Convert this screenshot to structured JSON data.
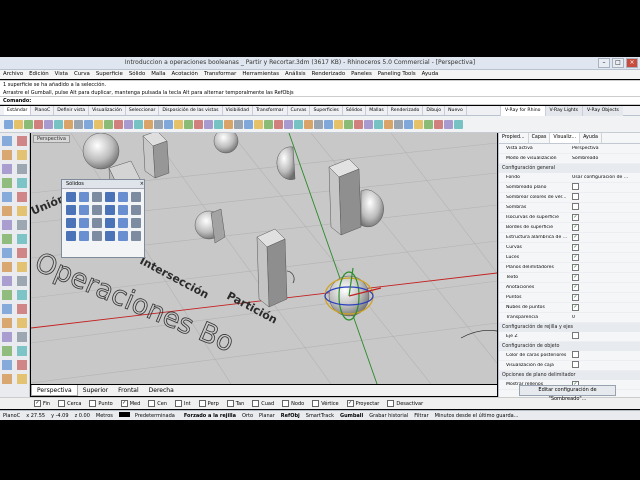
{
  "window": {
    "title": "Introduccion a operaciones booleanas _ Partir y Recortar.3dm (3617 KB) - Rhinoceros 5.0 Commercial - [Perspectiva]"
  },
  "menu": [
    "Archivo",
    "Edición",
    "Vista",
    "Curva",
    "Superficie",
    "Sólido",
    "Malla",
    "Acotación",
    "Transformar",
    "Herramientas",
    "Análisis",
    "Renderizado",
    "Paneles",
    "Paneling Tools",
    "Ayuda"
  ],
  "command_history": [
    "1 superficie se ha añadido a la selección.",
    "Arrastre el Gumball, pulse Alt para duplicar, mantenga pulsada la tecla Alt para alternar temporalmente las RefObjs"
  ],
  "command_prompt": "Comando:",
  "tabs": [
    "Estándar",
    "PlanoC",
    "Definir vista",
    "Visualización",
    "Seleccionar",
    "Disposición de las vistas",
    "Visibilidad",
    "Transformar",
    "Curvas",
    "Superficies",
    "Sólidos",
    "Mallas",
    "Renderizado",
    "Dibujo",
    "Nuevo"
  ],
  "active_tab_index": 0,
  "vray_tabs": [
    "V-Ray for Rhino",
    "V-Ray Lights",
    "V-Ray Objects"
  ],
  "viewport": {
    "label": "Perspectiva",
    "texts": {
      "union": "Unión",
      "interseccion": "Intersección",
      "particion": "Partición",
      "operaciones": "Operaciones Bo"
    }
  },
  "solids_panel": {
    "title": "Sólidos"
  },
  "viewport_tabs": [
    "Perspectiva",
    "Superior",
    "Frontal",
    "Derecha"
  ],
  "osnaps": [
    {
      "label": "Fin",
      "checked": true
    },
    {
      "label": "Cerca",
      "checked": false
    },
    {
      "label": "Punto",
      "checked": false
    },
    {
      "label": "Med",
      "checked": true
    },
    {
      "label": "Cen",
      "checked": false
    },
    {
      "label": "Int",
      "checked": false
    },
    {
      "label": "Perp",
      "checked": false
    },
    {
      "label": "Tan",
      "checked": false
    },
    {
      "label": "Cuad",
      "checked": false
    },
    {
      "label": "Nodo",
      "checked": false
    },
    {
      "label": "Vértice",
      "checked": false
    },
    {
      "label": "Proyectar",
      "checked": true
    },
    {
      "label": "Desactivar",
      "checked": false
    }
  ],
  "status": {
    "plane": "PlanoC",
    "x": "x 27.55",
    "y": "y -4.09",
    "z": "z 0.00",
    "units": "Metros",
    "layer": "Predeterminada",
    "buttons": [
      "Forzado a la rejilla",
      "Orto",
      "Planar",
      "RefObj",
      "SmartTrack",
      "Gumball",
      "Grabar historial",
      "Filtrar",
      "Minutos desde el último guarda..."
    ]
  },
  "right_panel": {
    "tabs": [
      "Propied...",
      "Capas",
      "Visualiz...",
      "Ayuda"
    ],
    "active_tab_index": 2,
    "rows": [
      {
        "k": "Vista activa",
        "v": "Perspectiva",
        "type": "text"
      },
      {
        "k": "Modo de visualización",
        "v": "Sombreado",
        "type": "text"
      },
      {
        "section": "Configuración general"
      },
      {
        "k": "Fondo",
        "v": "Usar configuración de ...",
        "type": "text"
      },
      {
        "k": "Sombreado plano",
        "checked": false,
        "type": "check"
      },
      {
        "k": "Sombrear colores de vér...",
        "checked": false,
        "type": "check"
      },
      {
        "k": "Sombras",
        "checked": false,
        "type": "check"
      },
      {
        "k": "Isocurvas de superficie",
        "checked": true,
        "type": "check"
      },
      {
        "k": "Bordes de superficie",
        "checked": true,
        "type": "check"
      },
      {
        "k": "Estructura alámbrica de ...",
        "checked": true,
        "type": "check"
      },
      {
        "k": "Curvas",
        "checked": true,
        "type": "check"
      },
      {
        "k": "Luces",
        "checked": true,
        "type": "check"
      },
      {
        "k": "Planos delimitadores",
        "checked": true,
        "type": "check"
      },
      {
        "k": "Texto",
        "checked": true,
        "type": "check"
      },
      {
        "k": "Anotaciones",
        "checked": true,
        "type": "check"
      },
      {
        "k": "Puntos",
        "checked": true,
        "type": "check"
      },
      {
        "k": "Nubes de puntos",
        "checked": true,
        "type": "check"
      },
      {
        "k": "Transparencia",
        "v": "0",
        "type": "text"
      },
      {
        "section": "Configuración de rejilla y ejes"
      },
      {
        "k": "Eje Z",
        "checked": false,
        "type": "check"
      },
      {
        "section": "Configuración de objeto"
      },
      {
        "k": "Color de caras posteriores",
        "checked": false,
        "type": "check"
      },
      {
        "k": "Visualización de caja",
        "checked": false,
        "type": "check"
      },
      {
        "section": "Opciones de plano delimitador"
      },
      {
        "k": "Mostrar rellenos",
        "checked": true,
        "type": "check"
      }
    ],
    "button": "Editar configuración de \"Sombreado\"..."
  }
}
